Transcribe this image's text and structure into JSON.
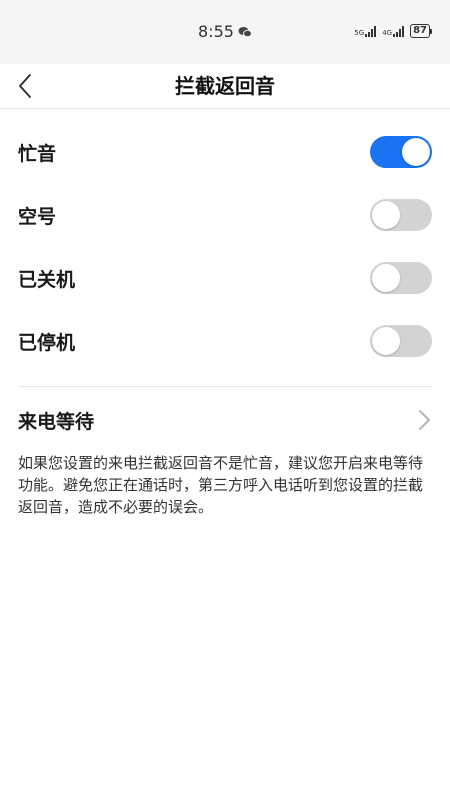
{
  "status_bar": {
    "time": "8:55",
    "network_1": "5G",
    "network_2": "4G",
    "battery": "87"
  },
  "header": {
    "title": "拦截返回音"
  },
  "options": [
    {
      "label": "忙音",
      "enabled": true
    },
    {
      "label": "空号",
      "enabled": false
    },
    {
      "label": "已关机",
      "enabled": false
    },
    {
      "label": "已停机",
      "enabled": false
    }
  ],
  "call_waiting": {
    "label": "来电等待"
  },
  "hint_text": "如果您设置的来电拦截返回音不是忙音，建议您开启来电等待功能。避免您正在通话时，第三方呼入电话听到您设置的拦截返回音，造成不必要的误会。",
  "colors": {
    "accent": "#1a73f0",
    "toggle_off": "#d3d3d3"
  }
}
